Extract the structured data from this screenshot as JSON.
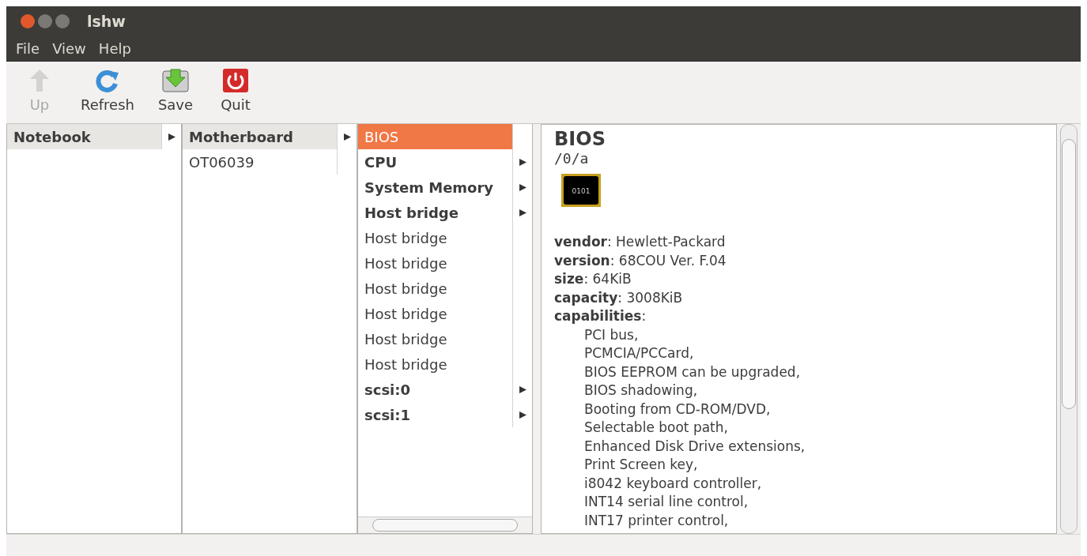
{
  "window": {
    "title": "lshw"
  },
  "menu": [
    "File",
    "View",
    "Help"
  ],
  "toolbar": [
    {
      "label": "Up",
      "kind": "up",
      "disabled": true
    },
    {
      "label": "Refresh",
      "kind": "refresh",
      "disabled": false
    },
    {
      "label": "Save",
      "kind": "save",
      "disabled": false
    },
    {
      "label": "Quit",
      "kind": "quit",
      "disabled": false
    }
  ],
  "columns": [
    {
      "active": false,
      "items": [
        {
          "label": "Notebook",
          "expandable": true,
          "selected": true
        }
      ]
    },
    {
      "active": false,
      "items": [
        {
          "label": "Motherboard",
          "expandable": true,
          "selected": true
        },
        {
          "label": "OT06039",
          "expandable": false,
          "selected": false
        }
      ]
    },
    {
      "active": true,
      "items": [
        {
          "label": "BIOS",
          "expandable": false,
          "selected": true
        },
        {
          "label": "CPU",
          "expandable": true,
          "selected": false
        },
        {
          "label": "System Memory",
          "expandable": true,
          "selected": false
        },
        {
          "label": "Host bridge",
          "expandable": true,
          "selected": false
        },
        {
          "label": "Host bridge",
          "expandable": false,
          "selected": false
        },
        {
          "label": "Host bridge",
          "expandable": false,
          "selected": false
        },
        {
          "label": "Host bridge",
          "expandable": false,
          "selected": false
        },
        {
          "label": "Host bridge",
          "expandable": false,
          "selected": false
        },
        {
          "label": "Host bridge",
          "expandable": false,
          "selected": false
        },
        {
          "label": "Host bridge",
          "expandable": false,
          "selected": false
        },
        {
          "label": "scsi:0",
          "expandable": true,
          "selected": false
        },
        {
          "label": "scsi:1",
          "expandable": true,
          "selected": false
        }
      ]
    }
  ],
  "detail": {
    "title": "BIOS",
    "path": "/0/a",
    "chip_label": "0101",
    "fields": [
      {
        "key": "vendor",
        "value": ": Hewlett-Packard"
      },
      {
        "key": "version",
        "value": ": 68COU Ver. F.04"
      },
      {
        "key": "size",
        "value": ": 64KiB"
      },
      {
        "key": "capacity",
        "value": ": 3008KiB"
      },
      {
        "key": "capabilities",
        "value": ":"
      }
    ],
    "capabilities": [
      "PCI bus,",
      "PCMCIA/PCCard,",
      "BIOS EEPROM can be upgraded,",
      "BIOS shadowing,",
      "Booting from CD-ROM/DVD,",
      "Selectable boot path,",
      "Enhanced Disk Drive extensions,",
      "Print Screen key,",
      "i8042 keyboard controller,",
      "INT14 serial line control,",
      "INT17 printer control,"
    ]
  }
}
